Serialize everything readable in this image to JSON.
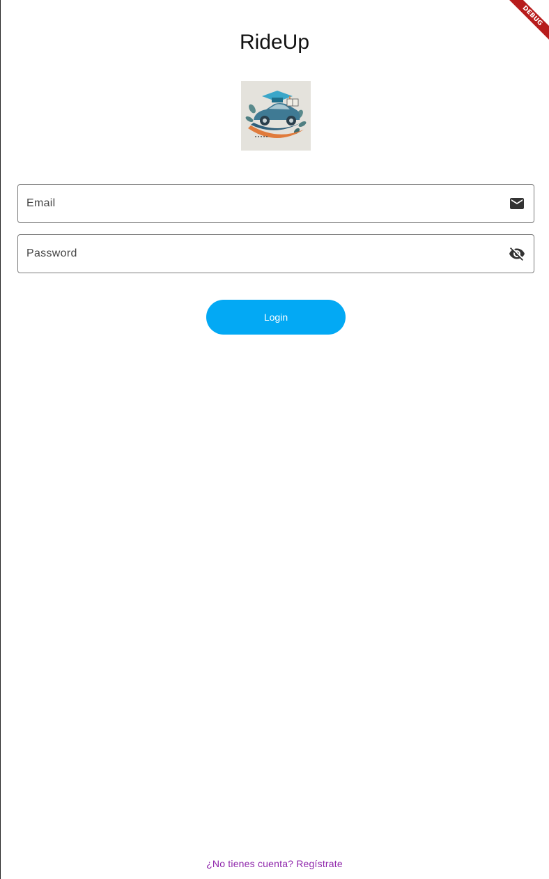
{
  "app": {
    "title": "RideUp",
    "debug_label": "DEBUG"
  },
  "form": {
    "email": {
      "placeholder": "Email",
      "value": "",
      "icon": "mail-icon"
    },
    "password": {
      "placeholder": "Password",
      "value": "",
      "icon": "visibility-off-icon"
    },
    "login_label": "Login"
  },
  "footer": {
    "signup_text": "¿No tienes cuenta? Regístrate"
  },
  "colors": {
    "accent": "#03a9f4",
    "link": "#8e24aa",
    "debug": "#b71c1c"
  }
}
